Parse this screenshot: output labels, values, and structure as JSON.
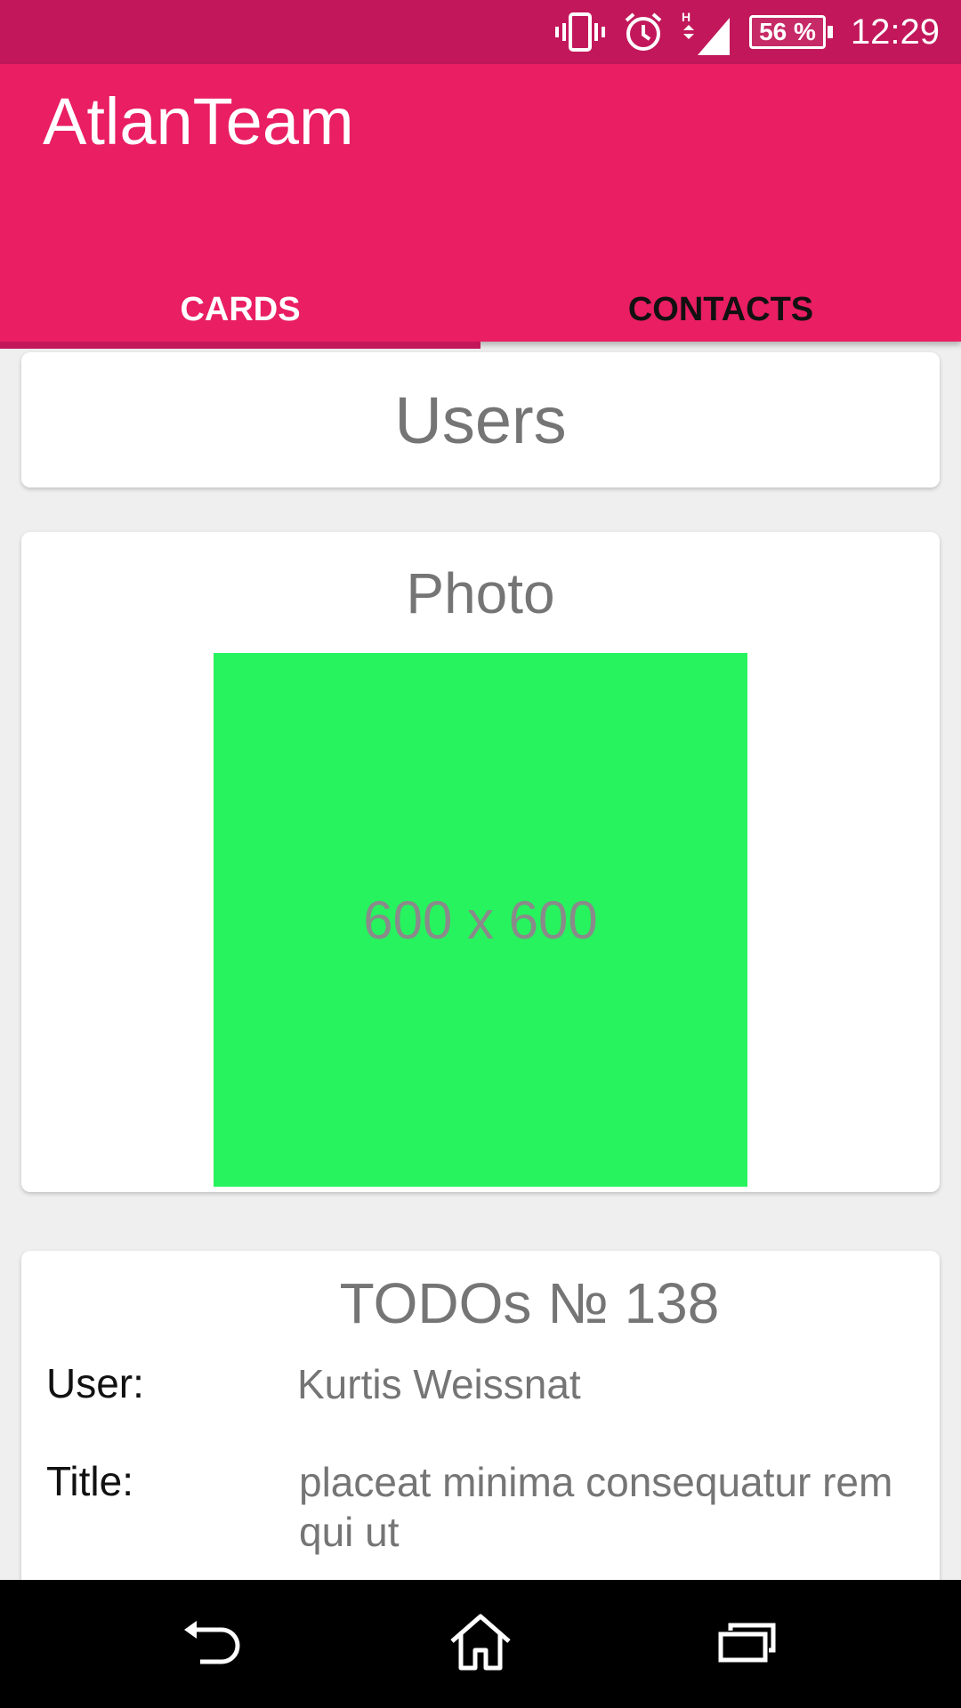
{
  "status_bar": {
    "battery": "56 %",
    "time": "12:29",
    "icons": [
      "vibrate-icon",
      "alarm-icon",
      "signal-icon",
      "battery-icon"
    ]
  },
  "app_bar": {
    "title": "AtlanTeam",
    "tabs": [
      {
        "label": "CARDS",
        "active": true
      },
      {
        "label": "CONTACTS",
        "active": false
      }
    ],
    "colors": {
      "primary": "#e91e63",
      "dark": "#c2185b"
    }
  },
  "cards": {
    "users": {
      "title": "Users"
    },
    "photo": {
      "title": "Photo",
      "placeholder": "600 x 600",
      "color": "#27f35e"
    },
    "todo": {
      "title": "TODOs № 138",
      "user_label": "User:",
      "user_value": "Kurtis Weissnat",
      "title_label": "Title:",
      "title_value": "placeat minima consequatur rem qui ut"
    }
  },
  "nav_bar": {
    "icons": [
      "back-icon",
      "home-icon",
      "recents-icon"
    ]
  }
}
